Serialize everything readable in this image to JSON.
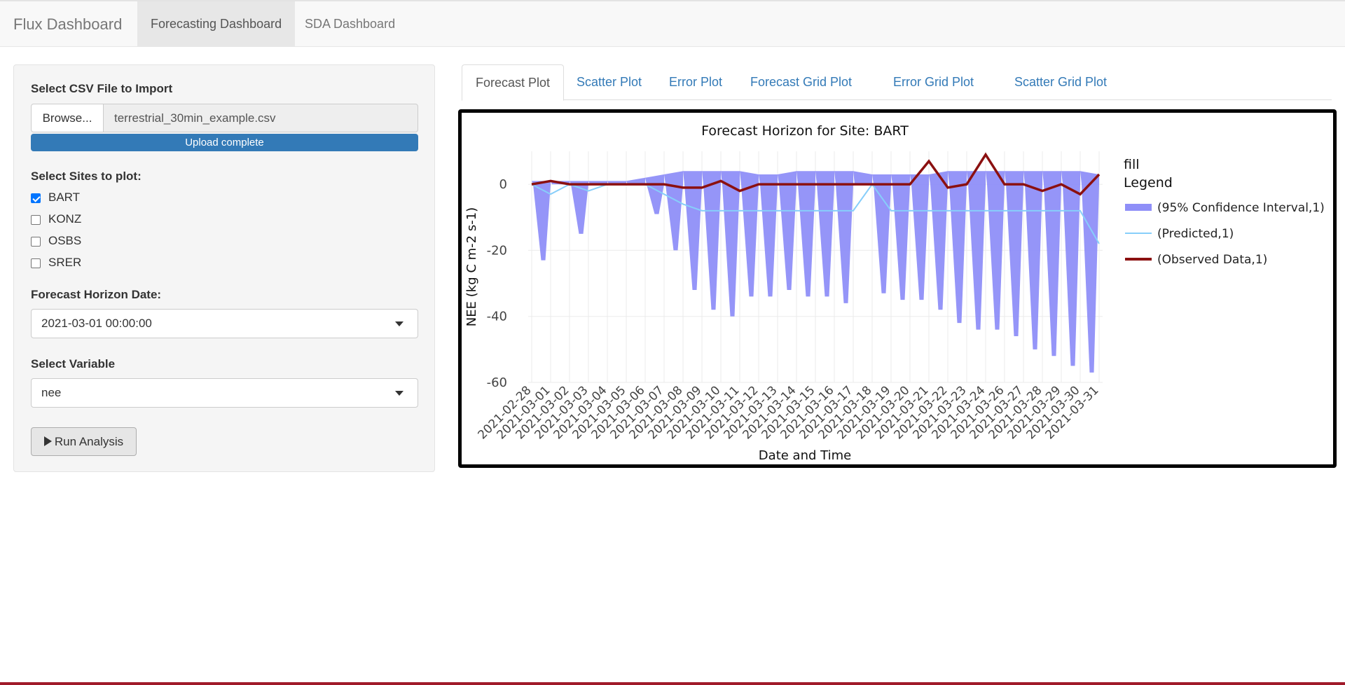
{
  "app": {
    "brand": "Flux Dashboard",
    "nav_tabs": [
      {
        "label": "Forecasting Dashboard",
        "active": true
      },
      {
        "label": "SDA Dashboard",
        "active": false
      }
    ]
  },
  "sidebar": {
    "file_label": "Select CSV File to Import",
    "browse_label": "Browse...",
    "file_name": "terrestrial_30min_example.csv",
    "upload_status": "Upload complete",
    "upload_progress": 1.0,
    "sites_label": "Select Sites to plot:",
    "sites": [
      {
        "label": "BART",
        "checked": true
      },
      {
        "label": "KONZ",
        "checked": false
      },
      {
        "label": "OSBS",
        "checked": false
      },
      {
        "label": "SRER",
        "checked": false
      }
    ],
    "horizon_label": "Forecast Horizon Date:",
    "horizon_value": "2021-03-01 00:00:00",
    "variable_label": "Select Variable",
    "variable_value": "nee",
    "run_label": "Run Analysis"
  },
  "tabs": [
    {
      "label": "Forecast Plot",
      "active": true
    },
    {
      "label": "Scatter Plot",
      "active": false
    },
    {
      "label": "Error Plot",
      "active": false
    },
    {
      "label": "Forecast Grid Plot",
      "active": false
    },
    {
      "label": "Error Grid Plot",
      "active": false
    },
    {
      "label": "Scatter Grid Plot",
      "active": false
    }
  ],
  "colors": {
    "accent": "#337ab7",
    "ci_fill": "#8f8ff8",
    "predicted": "#87cefa",
    "observed": "#8b1010"
  },
  "chart_data": {
    "type": "area",
    "title": "Forecast Horizon for Site: BART",
    "xlabel": "Date and Time",
    "ylabel": "NEE (kg C m-2 s-1)",
    "ylim": [
      -60,
      10
    ],
    "yticks": [
      0,
      -20,
      -40,
      -60
    ],
    "categories": [
      "2021-02-28",
      "2021-03-01",
      "2021-03-02",
      "2021-03-03",
      "2021-03-04",
      "2021-03-05",
      "2021-03-06",
      "2021-03-07",
      "2021-03-08",
      "2021-03-09",
      "2021-03-10",
      "2021-03-11",
      "2021-03-12",
      "2021-03-13",
      "2021-03-14",
      "2021-03-15",
      "2021-03-16",
      "2021-03-17",
      "2021-03-18",
      "2021-03-19",
      "2021-03-20",
      "2021-03-21",
      "2021-03-22",
      "2021-03-23",
      "2021-03-24",
      "2021-03-26",
      "2021-03-27",
      "2021-03-28",
      "2021-03-29",
      "2021-03-30",
      "2021-03-31"
    ],
    "legend_title": [
      "fill",
      "Legend"
    ],
    "legend_position": "right",
    "series": [
      {
        "name": "(95% Confidence Interval,1)",
        "kind": "band",
        "upper": [
          1,
          1,
          1,
          1,
          1,
          1,
          2,
          3,
          4,
          4,
          4,
          4,
          3,
          3,
          4,
          4,
          4,
          4,
          3,
          3,
          3,
          3,
          4,
          4,
          4,
          4,
          4,
          4,
          4,
          4,
          3
        ],
        "lower": [
          0,
          -23,
          0,
          -15,
          0,
          0,
          0,
          -9,
          -20,
          -32,
          -38,
          -40,
          -34,
          -34,
          -32,
          -34,
          -34,
          -36,
          0,
          -33,
          -35,
          -35,
          -38,
          -42,
          -44,
          -44,
          -46,
          -50,
          -52,
          -55,
          -57
        ]
      },
      {
        "name": "(Predicted,1)",
        "kind": "line",
        "values": [
          0,
          -3,
          0,
          -2,
          0,
          0,
          0,
          -3,
          -6,
          -8,
          -8,
          -8,
          -8,
          -8,
          -8,
          -8,
          -8,
          -8,
          0,
          -8,
          -8,
          -8,
          -8,
          -8,
          -8,
          -8,
          -8,
          -8,
          -8,
          -8,
          -18
        ]
      },
      {
        "name": "(Observed Data,1)",
        "kind": "line",
        "values": [
          0,
          1,
          0,
          0,
          0,
          0,
          0,
          0,
          -1,
          -1,
          1,
          -2,
          0,
          0,
          0,
          0,
          0,
          0,
          0,
          0,
          0,
          7,
          -1,
          0,
          9,
          0,
          0,
          -2,
          0,
          -3,
          3
        ]
      }
    ]
  }
}
